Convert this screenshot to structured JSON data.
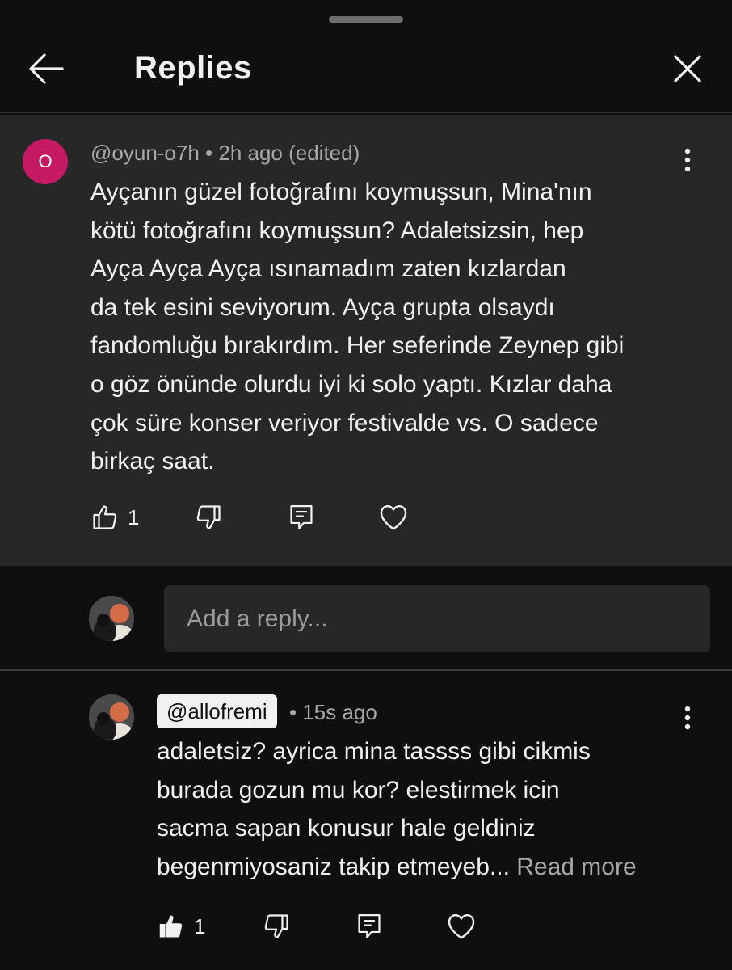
{
  "header": {
    "title": "Replies",
    "back_icon": "arrow-left-icon",
    "close_icon": "close-icon"
  },
  "parent_comment": {
    "avatar_letter": "O",
    "avatar_color": "#c51a63",
    "meta": "@oyun-o7h • 2h ago (edited)",
    "lines": [
      "Ayçanın güzel fotoğrafını koymuşsun, Mina'nın",
      "kötü fotoğrafını koymuşsun? Adaletsizsin, hep",
      "Ayça Ayça Ayça ısınamadım zaten kızlardan",
      "da tek esini seviyorum. Ayça grupta olsaydı",
      "fandomluğu bırakırdım. Her seferinde Zeynep gibi",
      "o göz önünde olurdu iyi ki solo yaptı. Kızlar daha",
      "çok süre konser veriyor festivalde vs. O sadece",
      "birkaç saat."
    ],
    "like_count": "1"
  },
  "reply_input": {
    "placeholder": "Add a reply..."
  },
  "reply": {
    "handle": "@allofremi",
    "time": "• 15s ago",
    "lines": [
      "adaletsiz? ayrica mina tassss gibi cikmis",
      "burada gozun mu kor? elestirmek icin",
      "sacma sapan konusur hale geldiniz"
    ],
    "last_line": "begenmiyosaniz takip etmeyeb...",
    "read_more": "Read more",
    "like_count": "1"
  }
}
